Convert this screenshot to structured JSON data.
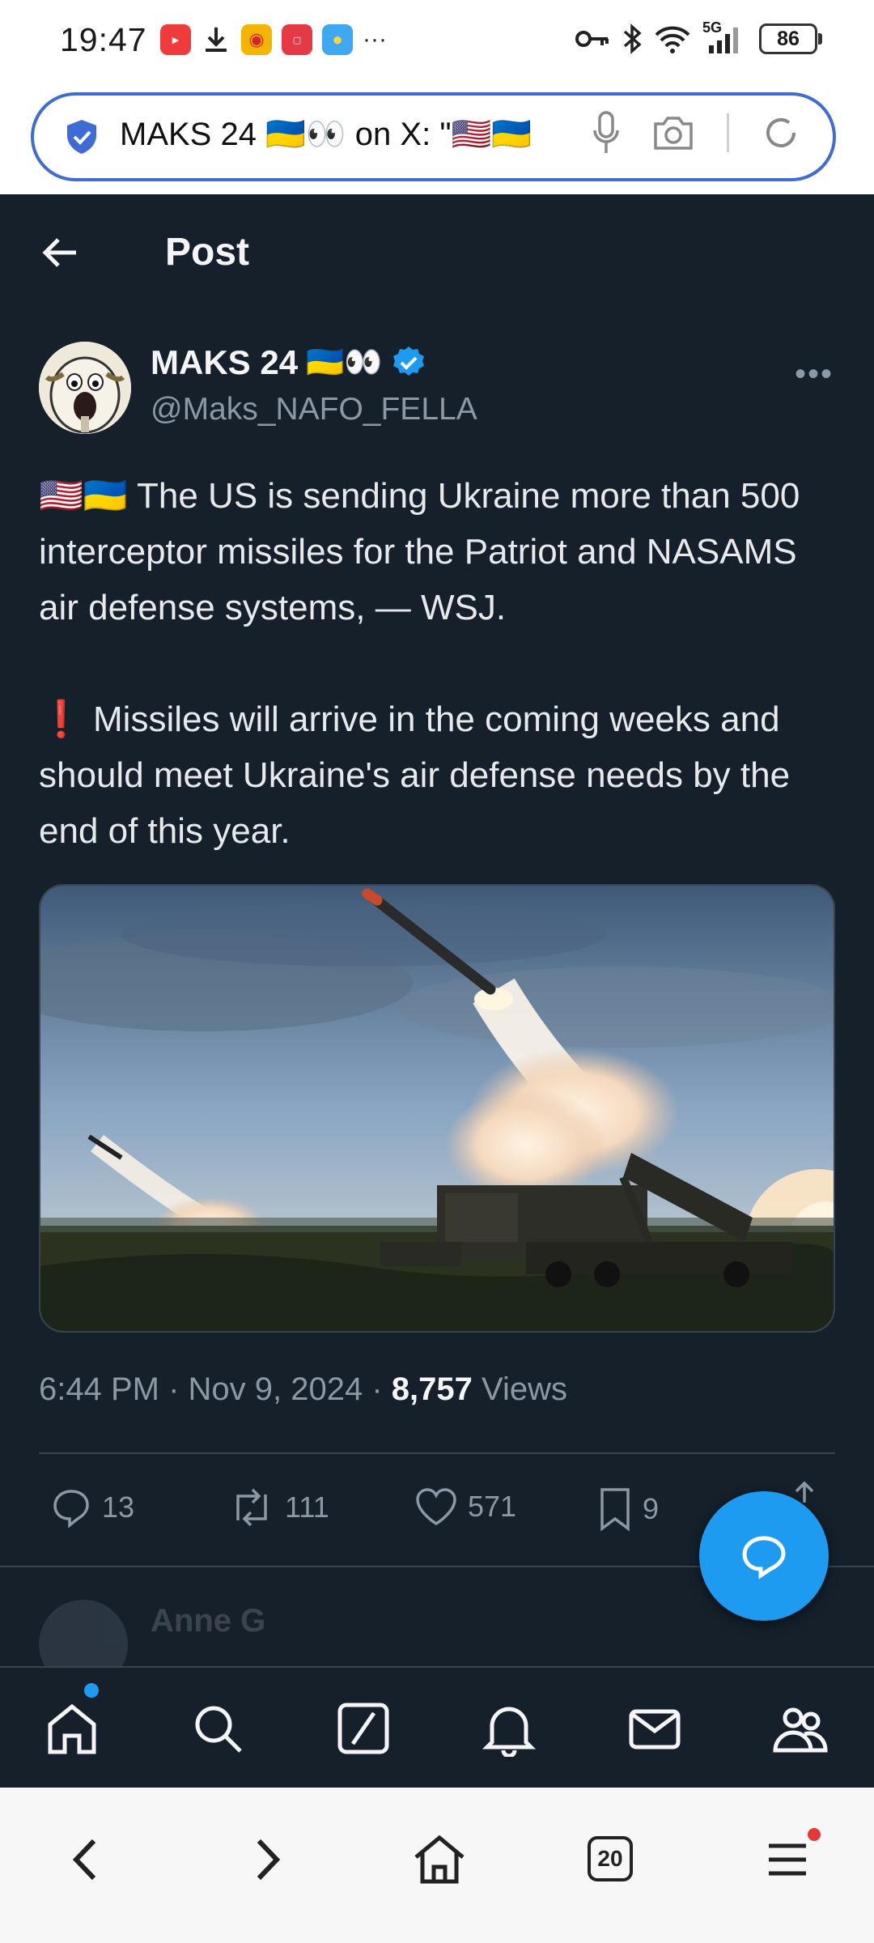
{
  "status_bar": {
    "time": "19:47",
    "network": "5G",
    "battery": "86",
    "app_icons": [
      "video-app-icon",
      "download-icon",
      "weibo-icon",
      "huawei-appgallery-icon",
      "weather-icon",
      "more-notifications-icon"
    ]
  },
  "browser": {
    "url_text": "MAKS 24 🇺🇦👀 on X: \"🇺🇸🇺🇦",
    "tab_count": "20"
  },
  "header": {
    "title": "Post"
  },
  "post": {
    "author_name": "MAKS 24",
    "author_emoji": "🇺🇦👀",
    "handle": "@Maks_NAFO_FELLA",
    "paragraph1": "🇺🇸🇺🇦 The US is sending Ukraine more than 500 interceptor missiles for the Patriot and NASAMS air defense systems, — WSJ.",
    "paragraph2": "❗ Missiles will arrive in the coming weeks and should meet Ukraine's air defense needs by the end of this year.",
    "time": "6:44 PM",
    "date": "Nov 9, 2024",
    "views_count": "8,757",
    "views_label": "Views",
    "replies": "13",
    "reposts": "111",
    "likes": "571",
    "bookmarks": "9"
  },
  "reply_preview": {
    "name": "Anne G"
  },
  "colors": {
    "background": "#15202b",
    "accent": "#1d9bf0",
    "secondary_text": "#8b98a5",
    "url_border": "#3e6bd6"
  }
}
